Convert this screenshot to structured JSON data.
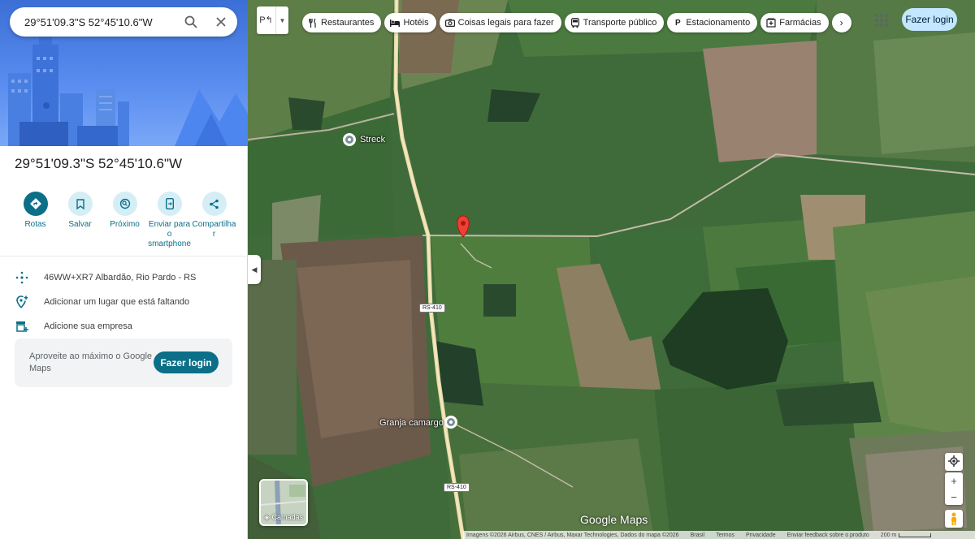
{
  "search": {
    "value": "29°51'09.3\"S 52°45'10.6\"W"
  },
  "place": {
    "title": "29°51'09.3\"S 52°45'10.6\"W"
  },
  "actions": [
    {
      "label": "Rotas",
      "icon": "directions-icon"
    },
    {
      "label": "Salvar",
      "icon": "bookmark-icon"
    },
    {
      "label": "Próximo",
      "icon": "nearby-icon"
    },
    {
      "label": "Enviar para o smartphone",
      "icon": "send-to-phone-icon"
    },
    {
      "label": "Compartilhar",
      "icon": "share-icon"
    }
  ],
  "info": {
    "plus_code": "46WW+XR7 Albardão, Rio Pardo - RS",
    "add_place": "Adicionar um lugar que está faltando",
    "add_business": "Adicione sua empresa"
  },
  "login_card": {
    "text": "Aproveite ao máximo o Google Maps",
    "button": "Fazer login"
  },
  "map": {
    "layer_toggle": "P↰",
    "chips": [
      {
        "label": "Restaurantes",
        "icon": "fork-knife-icon"
      },
      {
        "label": "Hotéis",
        "icon": "bed-icon"
      },
      {
        "label": "Coisas legais para fazer",
        "icon": "camera-icon"
      },
      {
        "label": "Transporte público",
        "icon": "bus-icon"
      },
      {
        "label": "Estacionamento",
        "icon": "parking-icon"
      },
      {
        "label": "Farmácias",
        "icon": "pharmacy-icon"
      }
    ],
    "login_button": "Fazer login",
    "places": [
      "Streck",
      "Granja camargo"
    ],
    "road_shields": [
      "RS-410",
      "RS-410"
    ],
    "layers_label": "Camadas",
    "watermark": "Google Maps",
    "footer": {
      "attribution": "Imagens ©2026 Airbus, CNES / Airbus, Maxar Technologies, Dados do mapa ©2026",
      "country": "Brasil",
      "terms": "Termos",
      "privacy": "Privacidade",
      "feedback": "Enviar feedback sobre o produto",
      "scale": "200 m"
    }
  },
  "colors": {
    "accent": "#0b6f88",
    "pin": "#ea4335",
    "chip_bg": "#ffffff",
    "login_top_bg": "#c2e7ff"
  }
}
